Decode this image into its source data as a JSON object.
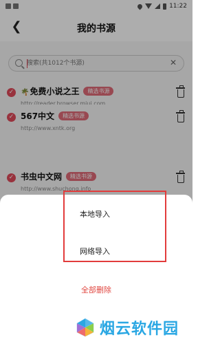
{
  "status_bar": {
    "time": "11:22"
  },
  "header": {
    "title": "我的书源"
  },
  "search": {
    "placeholder": "搜索(共1012个书源)"
  },
  "sources": [
    {
      "name": "免费小说之王",
      "tag": "精选书源",
      "url": "http://reader.browser.miui.com",
      "icon": "palm-tree-emoji"
    },
    {
      "name": "567中文",
      "tag": "精选书源",
      "url": "http://www.xntk.org"
    },
    {
      "name": "书虫中文网",
      "tag": "精选书源",
      "url": "http://www.shuchong.info"
    }
  ],
  "sheet": {
    "local_import": "本地导入",
    "network_import": "网络导入",
    "delete_all": "全部删除"
  },
  "watermark": {
    "text": "烟云软件园"
  },
  "colors": {
    "accent": "#e04a5a",
    "highlight_border": "#e23b3b",
    "watermark": "#2aa7e3"
  }
}
